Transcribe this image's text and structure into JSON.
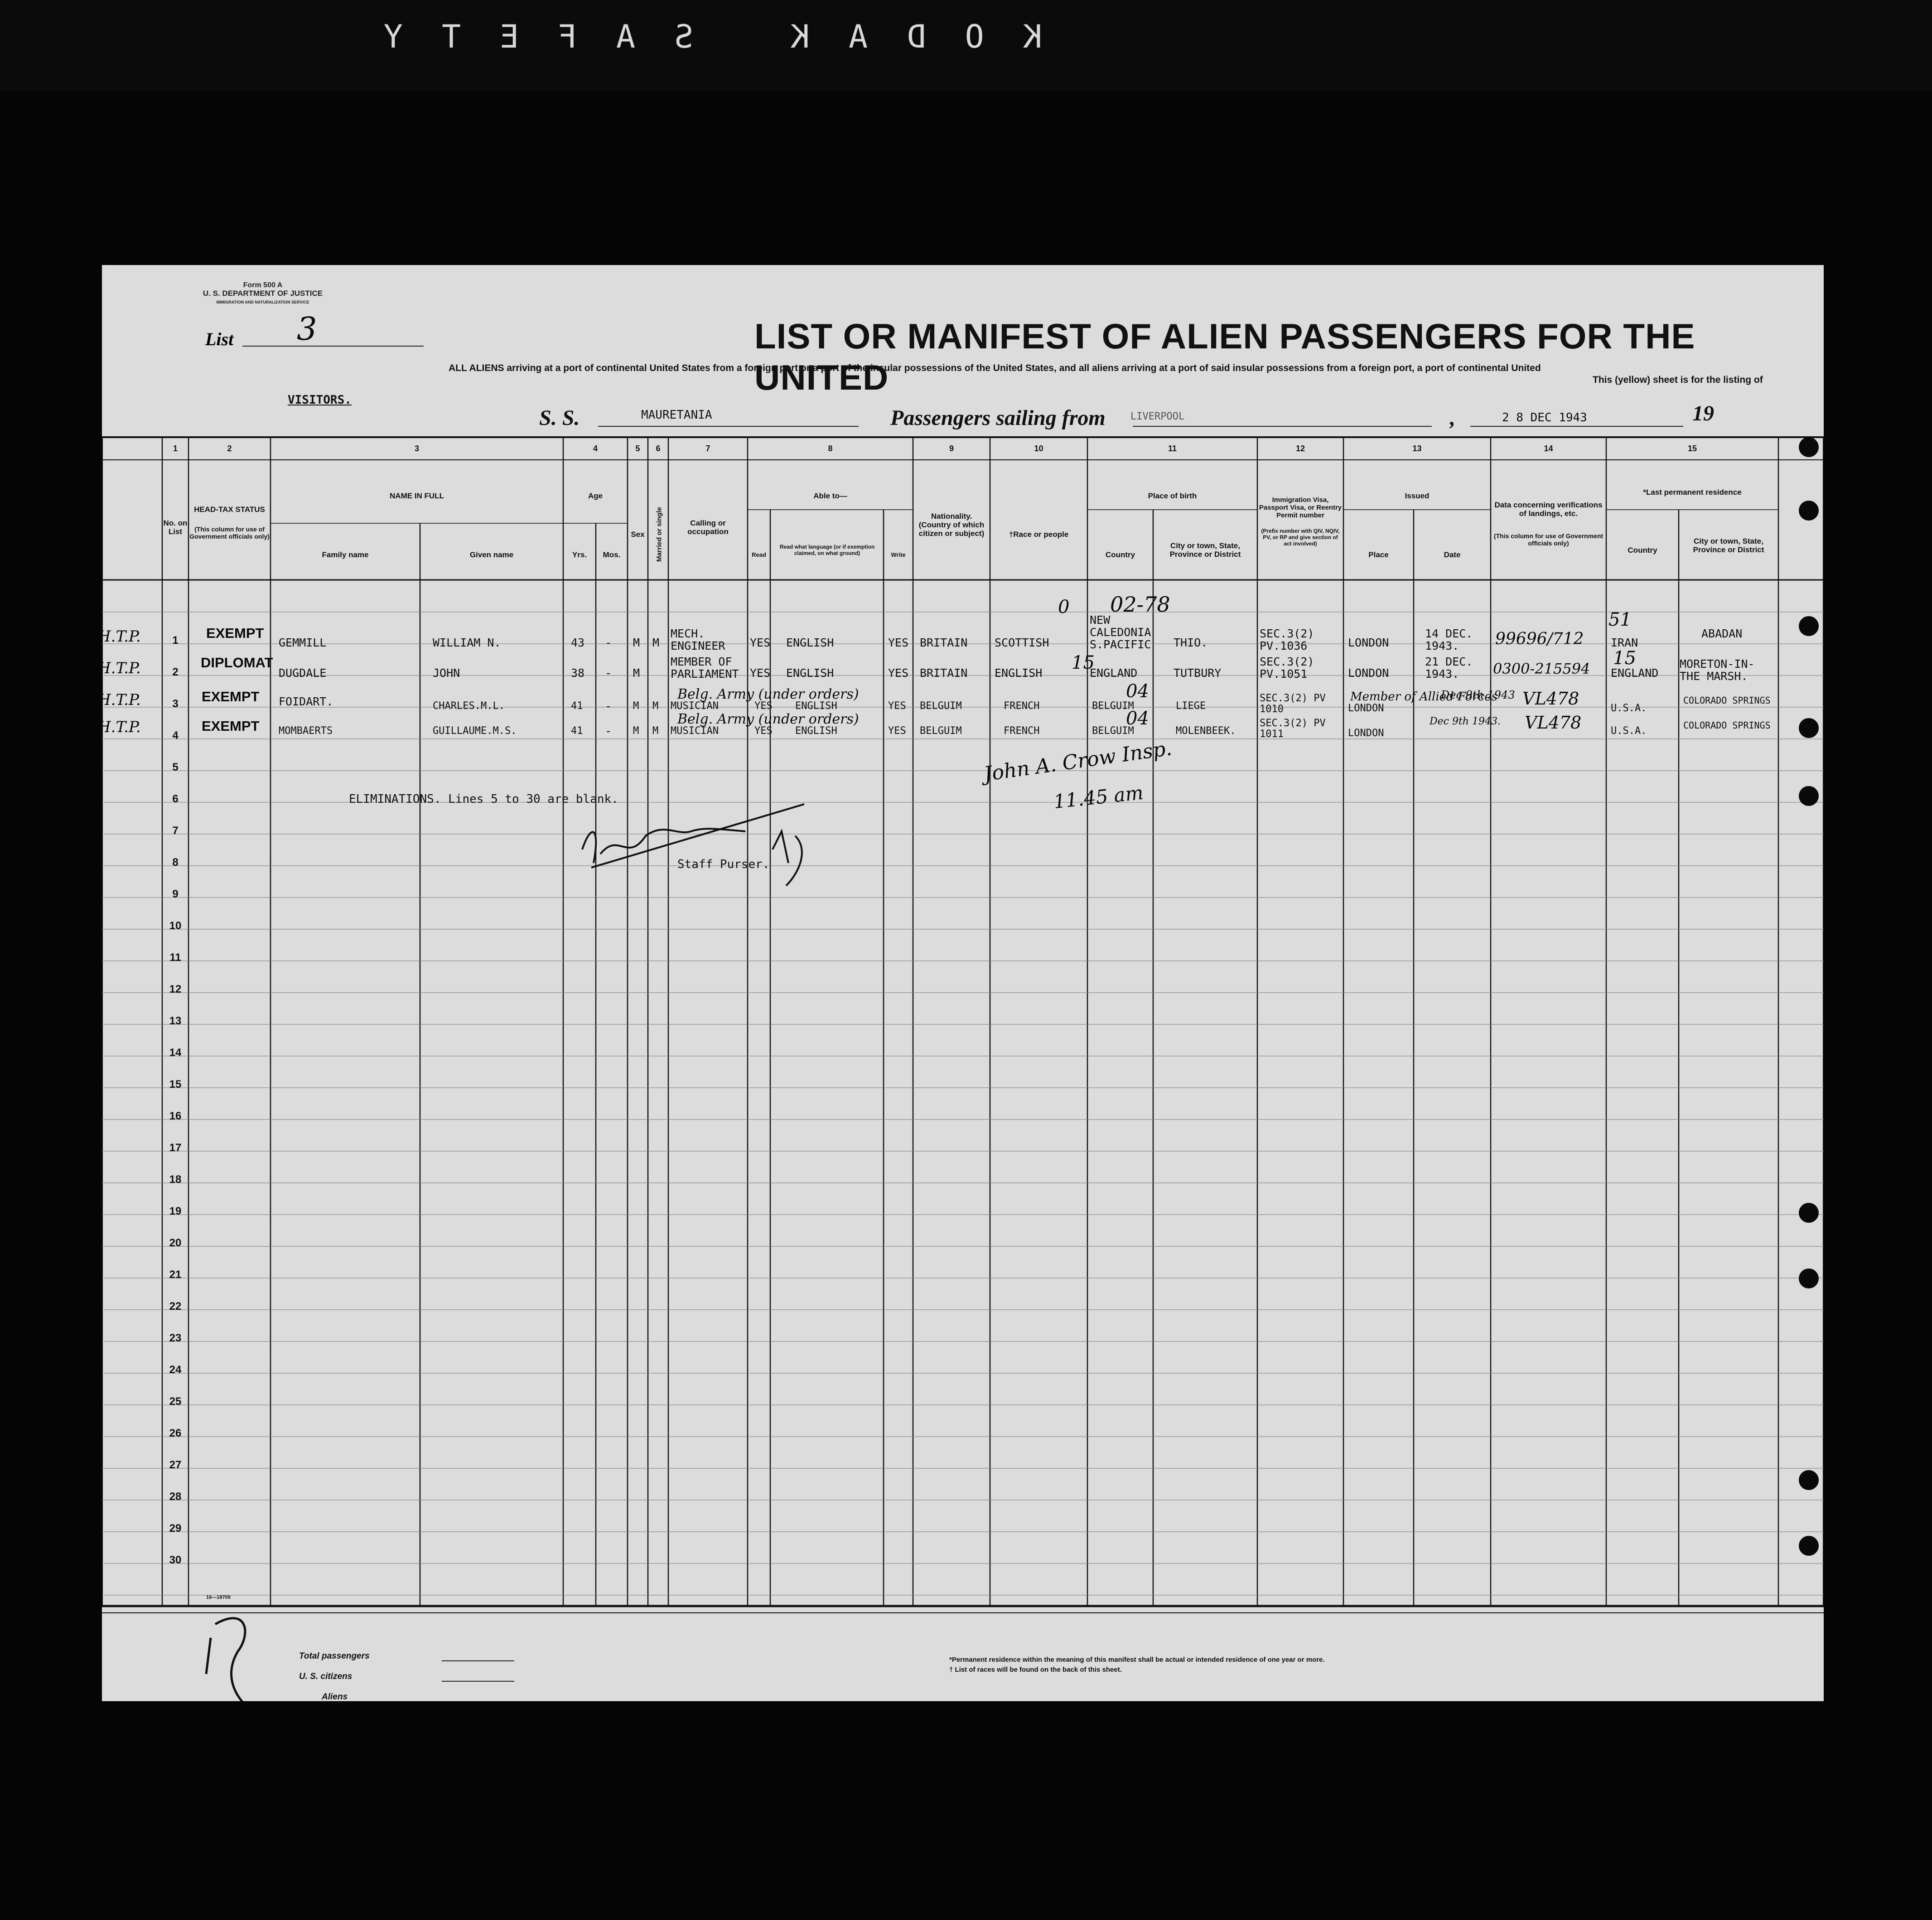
{
  "film_edge": "K O D A K   S A F E T Y",
  "form": {
    "form_number": "Form 500 A",
    "department": "U. S. DEPARTMENT OF JUSTICE",
    "service": "IMMIGRATION AND NATURALIZATION SERVICE",
    "list_label": "List",
    "list_number": "3",
    "title": "LIST OR MANIFEST OF ALIEN PASSENGERS FOR THE UNITED",
    "subtitle_1": "ALL ALIENS arriving at a port of continental United States from a foreign port or a port of the insular possessions of the United States, and all aliens arriving at a port of said insular possessions from a foreign port, a port of continental United",
    "subtitle_2": "This (yellow) sheet is for the listing of",
    "visitors": "VISITORS.",
    "ss_label": "S. S.",
    "ship": "MAURETANIA",
    "sailing_label": "Passengers sailing from",
    "port": "LIVERPOOL",
    "date": "2 8 DEC 1943",
    "year_suffix": "19"
  },
  "columns": {
    "col1": "No. on List",
    "col2": "HEAD-TAX STATUS",
    "col2_note": "(This column for use of Government officials only)",
    "col3": "NAME IN FULL",
    "family": "Family name",
    "given": "Given name",
    "col4": "Age",
    "yrs": "Yrs.",
    "mos": "Mos.",
    "col5": "Sex",
    "col6": "Married or single",
    "col7": "Calling or occupation",
    "col8": "Able to—",
    "read": "Read",
    "read_lang": "Read what language (or if exemption claimed, on what ground)",
    "write": "Write",
    "col9": "Nationality. (Country of which citizen or subject)",
    "col10": "†Race or people",
    "col11": "Place of birth",
    "country": "Country",
    "city": "City or town, State, Province or District",
    "col12": "Immigration Visa, Passport Visa, or Reentry Permit number",
    "col12_note": "(Prefix number with QIV, NQIV, PV, or RP and give section of act involved)",
    "col13": "Issued",
    "place": "Place",
    "date": "Date",
    "col14": "Data concerning verifications of landings, etc.",
    "col14_note": "(This column for use of Government officials only)",
    "col15": "*Last permanent residence",
    "country15": "Country",
    "city15": "City or town, State, Province or District",
    "numbers": [
      "1",
      "2",
      "3",
      "4",
      "5",
      "6",
      "7",
      "8",
      "9",
      "10",
      "11",
      "12",
      "13",
      "14",
      "15"
    ]
  },
  "row_numbers": [
    "1",
    "2",
    "3",
    "4",
    "5",
    "6",
    "7",
    "8",
    "9",
    "10",
    "11",
    "12",
    "13",
    "14",
    "15",
    "16",
    "17",
    "18",
    "19",
    "20",
    "21",
    "22",
    "23",
    "24",
    "25",
    "26",
    "27",
    "28",
    "29",
    "30"
  ],
  "passengers": [
    {
      "margin": "H.T.P.",
      "status": "EXEMPT",
      "family": "GEMMILL",
      "given": "WILLIAM N.",
      "yrs": "43",
      "mos": "-",
      "sex": "M",
      "married": "M",
      "occupation": "MECH. ENGINEER",
      "read": "YES",
      "language": "ENGLISH",
      "write": "YES",
      "nationality": "BRITAIN",
      "race": "SCOTTISH",
      "birth_country": "NEW CALEDONIA S.PACIFIC",
      "birth_city": "THIO.",
      "visa": "SEC.3(2) PV.1036",
      "issued_place": "LONDON",
      "issued_date": "14 DEC. 1943.",
      "verification": "99696/712",
      "res_country": "IRAN",
      "res_city": "ABADAN"
    },
    {
      "margin": "H.T.P.",
      "status": "DIPLOMAT",
      "family": "DUGDALE",
      "given": "JOHN",
      "yrs": "38",
      "mos": "-",
      "sex": "M",
      "married": "",
      "occupation": "MEMBER OF PARLIAMENT",
      "read": "YES",
      "language": "ENGLISH",
      "write": "YES",
      "nationality": "BRITAIN",
      "race": "ENGLISH",
      "birth_country": "ENGLAND",
      "birth_city": "TUTBURY",
      "visa": "SEC.3(2) PV.1051",
      "issued_place": "LONDON",
      "issued_date": "21 DEC. 1943.",
      "verification": "0300-215594",
      "res_country": "ENGLAND",
      "res_city": "MORETON-IN-THE MARSH."
    },
    {
      "margin": "H.T.P.",
      "status": "EXEMPT",
      "family": "FOIDART.",
      "given": "CHARLES.M.L.",
      "yrs": "41",
      "mos": "-",
      "sex": "M",
      "married": "M",
      "occupation": "MUSICIAN",
      "read": "YES",
      "language": "ENGLISH",
      "write": "YES",
      "nationality": "BELGUIM",
      "race": "FRENCH",
      "birth_country": "BELGUIM",
      "birth_city": "LIEGE",
      "visa": "SEC.3(2) PV 1010",
      "issued_place": "LONDON",
      "issued_date": "Dec 9th 1943",
      "verification": "VL478",
      "res_country": "U.S.A.",
      "res_city": "COLORADO SPRINGS"
    },
    {
      "margin": "H.T.P.",
      "status": "EXEMPT",
      "family": "MOMBAERTS",
      "given": "GUILLAUME.M.S.",
      "yrs": "41",
      "mos": "-",
      "sex": "M",
      "married": "M",
      "occupation": "MUSICIAN",
      "read": "YES",
      "language": "ENGLISH",
      "write": "YES",
      "nationality": "BELGUIM",
      "race": "FRENCH",
      "birth_country": "BELGUIM",
      "birth_city": "MOLENBEEK.",
      "visa": "SEC.3(2) PV 1011",
      "issued_place": "LONDON",
      "issued_date": "Dec 9th 1943.",
      "verification": "VL478",
      "res_country": "U.S.A.",
      "res_city": "COLORADO SPRINGS"
    }
  ],
  "annotations": {
    "eliminations": "ELIMINATIONS.  Lines 5 to 30 are blank.",
    "staff_purser": "Staff Purser.",
    "signature_note": "John A. Crow Insp.",
    "time_note": "11.45 am",
    "codes": {
      "row1": "02-78",
      "row1_race": "0",
      "res1": "51",
      "row2": "15",
      "row2_res": "15",
      "row3": "04",
      "row4": "04"
    },
    "belg_army_1": "Belg. Army (under orders)",
    "belg_army_2": "Belg. Army (under orders)",
    "allied_note": "Member of Allied Forces"
  },
  "footer": {
    "total_label": "Total passengers",
    "us_label": "U. S. citizens",
    "aliens_label": "Aliens",
    "tally_mark": "7",
    "note_1": "*Permanent residence within the meaning of this manifest shall be actual or intended residence of one year or more.",
    "note_2": "† List of races will be found on the back of this sheet.",
    "print_code": "16—18709"
  }
}
